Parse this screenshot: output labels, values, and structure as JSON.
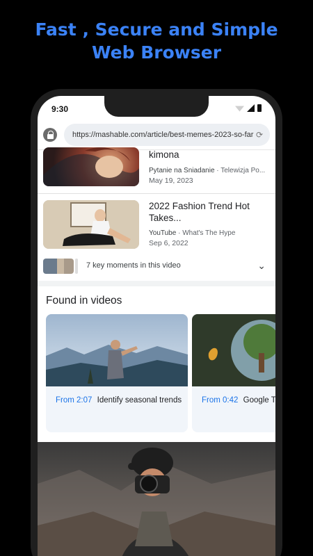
{
  "headline": {
    "line1": "Fast , Secure and Simple",
    "line2": "Web Browser"
  },
  "status_bar": {
    "time": "9:30"
  },
  "browser": {
    "url": "https://mashable.com/article/best-memes-2023-so-far",
    "reload_icon": "reload-icon",
    "lock_icon": "lock-icon"
  },
  "results": [
    {
      "title": "kimona",
      "source": "Pytanie na Śniadanie",
      "channel": "Telewizja Po...",
      "date": "May 19, 2023"
    },
    {
      "title": "2022 Fashion Trend Hot Takes...",
      "source": "YouTube",
      "channel": "What's The Hype",
      "date": "Sep 6, 2022"
    }
  ],
  "key_moments": {
    "label": "7 key moments in this video",
    "chevron_icon": "chevron-down-icon"
  },
  "found_in_videos": {
    "title": "Found in videos",
    "cards": [
      {
        "from": "From 2:07",
        "caption": "Identify seasonal trends"
      },
      {
        "from": "From 0:42",
        "caption": "Google T"
      }
    ]
  },
  "colors": {
    "accent": "#3b82f6",
    "link": "#1a73e8"
  }
}
